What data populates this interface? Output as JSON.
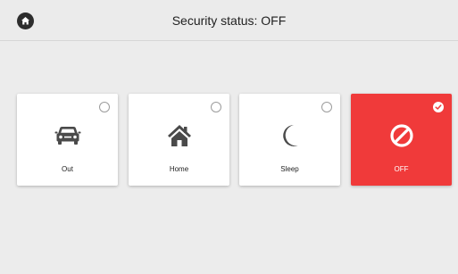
{
  "header": {
    "title": "Security status: OFF",
    "home_icon": "home-icon"
  },
  "modes": [
    {
      "label": "Out",
      "icon": "car-icon",
      "selected": false
    },
    {
      "label": "Home",
      "icon": "house-icon",
      "selected": false
    },
    {
      "label": "Sleep",
      "icon": "moon-icon",
      "selected": false
    },
    {
      "label": "OFF",
      "icon": "prohibited-icon",
      "selected": true
    }
  ],
  "colors": {
    "active_card": "#f03a3a",
    "icon_dark": "#4a4a4a",
    "background": "#ececec"
  }
}
